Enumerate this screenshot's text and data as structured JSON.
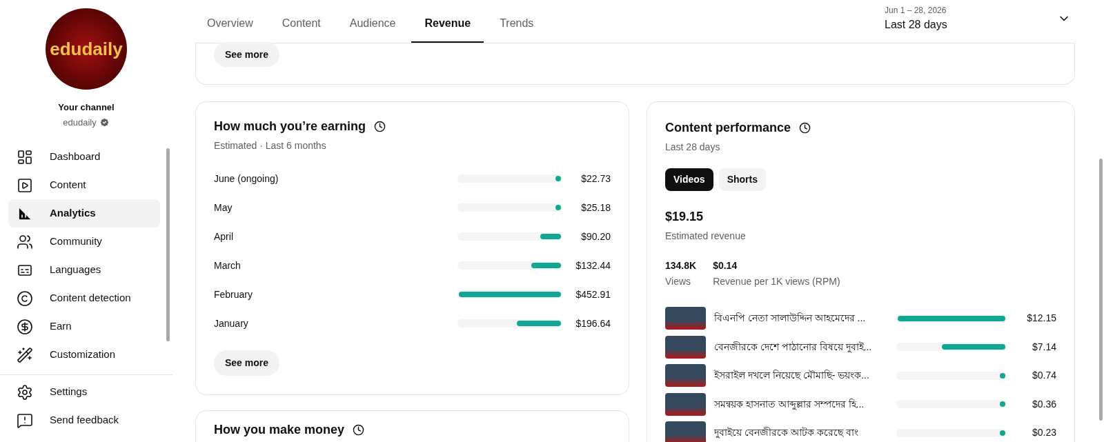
{
  "sidebar": {
    "channel_label": "Your channel",
    "channel_name": "edudaily",
    "logo_text": "edudaily",
    "verified": true,
    "items": [
      {
        "label": "Dashboard",
        "selected": false
      },
      {
        "label": "Content",
        "selected": false
      },
      {
        "label": "Analytics",
        "selected": true
      },
      {
        "label": "Community",
        "selected": false
      },
      {
        "label": "Languages",
        "selected": false
      },
      {
        "label": "Content detection",
        "selected": false
      },
      {
        "label": "Earn",
        "selected": false
      },
      {
        "label": "Customization",
        "selected": false
      }
    ],
    "bottom_items": [
      {
        "label": "Settings"
      },
      {
        "label": "Send feedback"
      }
    ]
  },
  "tabs": [
    {
      "label": "Overview",
      "selected": false
    },
    {
      "label": "Content",
      "selected": false
    },
    {
      "label": "Audience",
      "selected": false
    },
    {
      "label": "Revenue",
      "selected": true
    },
    {
      "label": "Trends",
      "selected": false
    }
  ],
  "date_range": {
    "dates": "Jun 1 – 28, 2026",
    "label": "Last 28 days"
  },
  "top_card": {
    "button": "See more"
  },
  "earning": {
    "title": "How much you’re earning",
    "subtitle": "Estimated · Last 6 months",
    "rows": [
      {
        "month": "June (ongoing)",
        "value": "$22.73",
        "level": 0.05
      },
      {
        "month": "May",
        "value": "$25.18",
        "level": 0.05
      },
      {
        "month": "April",
        "value": "$90.20",
        "level": 0.2
      },
      {
        "month": "March",
        "value": "$132.44",
        "level": 0.29
      },
      {
        "month": "February",
        "value": "$452.91",
        "level": 1
      },
      {
        "month": "January",
        "value": "$196.64",
        "level": 0.43
      }
    ],
    "button": "See more"
  },
  "make_money": {
    "title": "How you make money"
  },
  "performance": {
    "title": "Content performance",
    "subtitle": "Last 28 days",
    "chips": [
      {
        "label": "Videos",
        "selected": true
      },
      {
        "label": "Shorts",
        "selected": false
      }
    ],
    "total": "$19.15",
    "total_label": "Estimated revenue",
    "stats": [
      {
        "value": "134.8K",
        "label": "Views"
      },
      {
        "value": "$0.14",
        "label": "Revenue per 1K views (RPM)"
      }
    ],
    "videos": [
      {
        "title": "বিএনপি নেতা সালাউদ্দিন আহমেদের ...",
        "value": "$12.15",
        "level": 1
      },
      {
        "title": "বেনজীরকে দেশে পাঠানোর বিষয়ে দুবাই...",
        "value": "$7.14",
        "level": 0.59
      },
      {
        "title": "ইসরাইল দখলে নিয়েছে মৌমাছি- ভয়ংক...",
        "value": "$0.74",
        "level": 0.04
      },
      {
        "title": "সমন্বয়ক হাসনাত আব্দুল্লার সম্পদের হি...",
        "value": "$0.36",
        "level": 0.03
      },
      {
        "title": "দুবাইয়ে বেনজীরকে আটক করেছে বাং",
        "value": "$0.23",
        "level": 0.02
      }
    ]
  }
}
